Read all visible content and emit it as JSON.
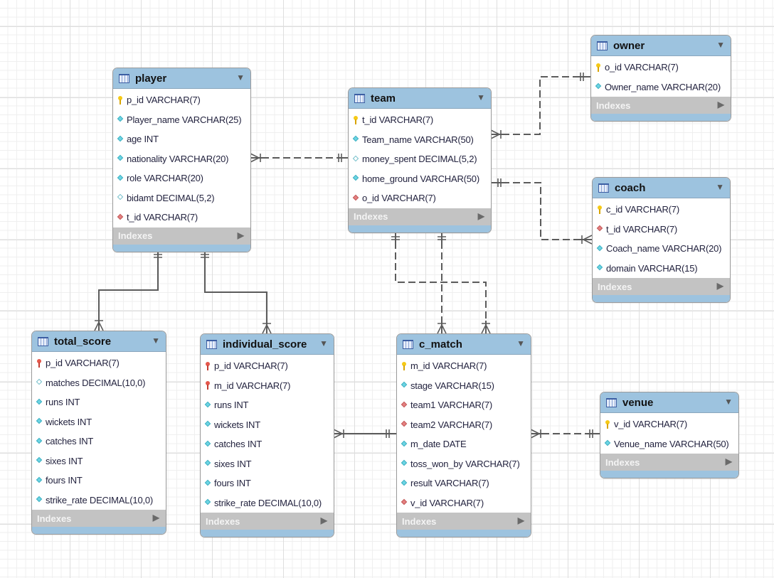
{
  "diagram": {
    "type": "EER diagram",
    "grid": true
  },
  "ui": {
    "collapse_glyph": "▼",
    "expand_glyph": "▶"
  },
  "colors": {
    "header": "#9dc3df",
    "indexes_bar": "#c3c3c3",
    "connector": "#5b5b5b",
    "primary_key": "#f5c916",
    "foreign_key": "#e58080",
    "not_null": "#6cd4e3"
  },
  "tables": {
    "player": {
      "name": "player",
      "indexes_label": "Indexes",
      "columns": [
        {
          "text": "p_id VARCHAR(7)",
          "icon": "primary-key"
        },
        {
          "text": "Player_name VARCHAR(25)",
          "icon": "not-null"
        },
        {
          "text": "age INT",
          "icon": "not-null"
        },
        {
          "text": "nationality VARCHAR(20)",
          "icon": "not-null"
        },
        {
          "text": "role VARCHAR(20)",
          "icon": "not-null"
        },
        {
          "text": "bidamt DECIMAL(5,2)",
          "icon": "nullable"
        },
        {
          "text": "t_id VARCHAR(7)",
          "icon": "foreign-key"
        }
      ]
    },
    "team": {
      "name": "team",
      "indexes_label": "Indexes",
      "columns": [
        {
          "text": "t_id VARCHAR(7)",
          "icon": "primary-key"
        },
        {
          "text": "Team_name VARCHAR(50)",
          "icon": "not-null"
        },
        {
          "text": "money_spent DECIMAL(5,2)",
          "icon": "nullable"
        },
        {
          "text": "home_ground VARCHAR(50)",
          "icon": "not-null"
        },
        {
          "text": "o_id VARCHAR(7)",
          "icon": "foreign-key"
        }
      ]
    },
    "owner": {
      "name": "owner",
      "indexes_label": "Indexes",
      "columns": [
        {
          "text": "o_id VARCHAR(7)",
          "icon": "primary-key"
        },
        {
          "text": "Owner_name VARCHAR(20)",
          "icon": "not-null"
        }
      ]
    },
    "coach": {
      "name": "coach",
      "indexes_label": "Indexes",
      "columns": [
        {
          "text": "c_id VARCHAR(7)",
          "icon": "primary-key"
        },
        {
          "text": "t_id VARCHAR(7)",
          "icon": "foreign-key"
        },
        {
          "text": "Coach_name VARCHAR(20)",
          "icon": "not-null"
        },
        {
          "text": "domain VARCHAR(15)",
          "icon": "not-null"
        }
      ]
    },
    "total_score": {
      "name": "total_score",
      "indexes_label": "Indexes",
      "columns": [
        {
          "text": "p_id VARCHAR(7)",
          "icon": "primary-foreign-key"
        },
        {
          "text": "matches DECIMAL(10,0)",
          "icon": "nullable"
        },
        {
          "text": "runs INT",
          "icon": "not-null"
        },
        {
          "text": "wickets INT",
          "icon": "not-null"
        },
        {
          "text": "catches INT",
          "icon": "not-null"
        },
        {
          "text": "sixes INT",
          "icon": "not-null"
        },
        {
          "text": "fours INT",
          "icon": "not-null"
        },
        {
          "text": "strike_rate DECIMAL(10,0)",
          "icon": "not-null"
        }
      ]
    },
    "individual_score": {
      "name": "individual_score",
      "indexes_label": "Indexes",
      "columns": [
        {
          "text": "p_id VARCHAR(7)",
          "icon": "primary-foreign-key"
        },
        {
          "text": "m_id VARCHAR(7)",
          "icon": "primary-foreign-key"
        },
        {
          "text": "runs INT",
          "icon": "not-null"
        },
        {
          "text": "wickets INT",
          "icon": "not-null"
        },
        {
          "text": "catches INT",
          "icon": "not-null"
        },
        {
          "text": "sixes INT",
          "icon": "not-null"
        },
        {
          "text": "fours INT",
          "icon": "not-null"
        },
        {
          "text": "strike_rate DECIMAL(10,0)",
          "icon": "not-null"
        }
      ]
    },
    "c_match": {
      "name": "c_match",
      "indexes_label": "Indexes",
      "columns": [
        {
          "text": "m_id VARCHAR(7)",
          "icon": "primary-key"
        },
        {
          "text": "stage VARCHAR(15)",
          "icon": "not-null"
        },
        {
          "text": "team1 VARCHAR(7)",
          "icon": "foreign-key"
        },
        {
          "text": "team2 VARCHAR(7)",
          "icon": "foreign-key"
        },
        {
          "text": "m_date DATE",
          "icon": "not-null"
        },
        {
          "text": "toss_won_by VARCHAR(7)",
          "icon": "not-null"
        },
        {
          "text": "result VARCHAR(7)",
          "icon": "not-null"
        },
        {
          "text": "v_id VARCHAR(7)",
          "icon": "foreign-key"
        }
      ]
    },
    "venue": {
      "name": "venue",
      "indexes_label": "Indexes",
      "columns": [
        {
          "text": "v_id VARCHAR(7)",
          "icon": "primary-key"
        },
        {
          "text": "Venue_name VARCHAR(50)",
          "icon": "not-null"
        }
      ]
    }
  },
  "relationships": [
    {
      "child": "player",
      "parent": "team",
      "cardinality": "many-to-one",
      "identifying": false
    },
    {
      "child": "team",
      "parent": "owner",
      "cardinality": "many-to-one",
      "identifying": false
    },
    {
      "child": "coach",
      "parent": "team",
      "cardinality": "many-to-one",
      "identifying": false
    },
    {
      "child": "c_match",
      "parent": "team",
      "via": "team1",
      "cardinality": "many-to-one",
      "identifying": false
    },
    {
      "child": "c_match",
      "parent": "team",
      "via": "team2",
      "cardinality": "many-to-one",
      "identifying": false
    },
    {
      "child": "total_score",
      "parent": "player",
      "cardinality": "many-to-one",
      "identifying": true
    },
    {
      "child": "individual_score",
      "parent": "player",
      "cardinality": "many-to-one",
      "identifying": true
    },
    {
      "child": "individual_score",
      "parent": "c_match",
      "cardinality": "many-to-one",
      "identifying": true
    },
    {
      "child": "c_match",
      "parent": "venue",
      "cardinality": "many-to-one",
      "identifying": false
    }
  ]
}
